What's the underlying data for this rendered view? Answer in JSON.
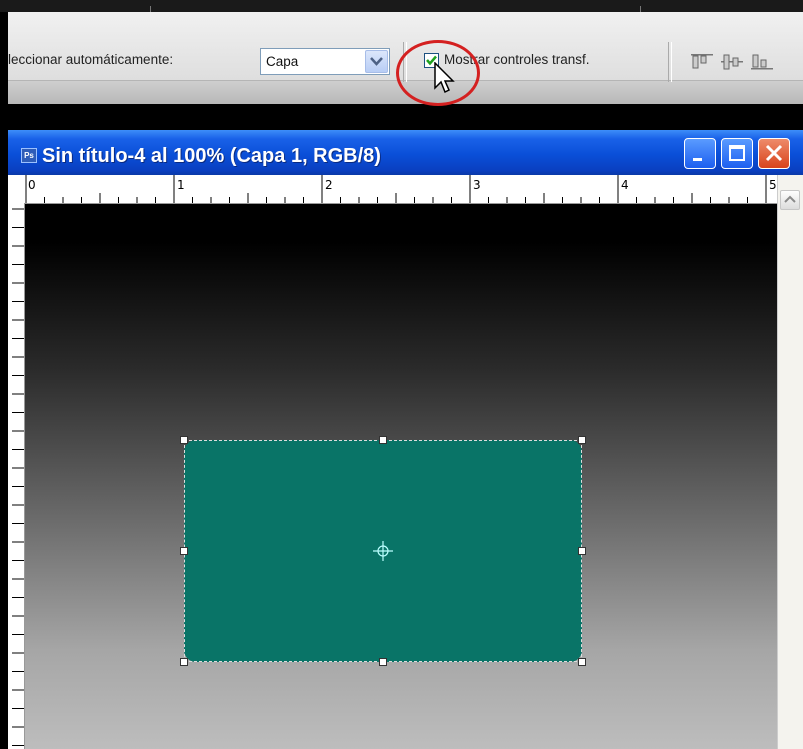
{
  "options_bar": {
    "autoselect_label": "leccionar automáticamente:",
    "autoselect_value": "Capa",
    "show_transform_label": "Mostrar controles transf.",
    "show_transform_checked": true
  },
  "document": {
    "title": "Sin título-4 al 100% (Capa 1, RGB/8)",
    "app_badge": "Ps"
  },
  "ruler": {
    "h_labels": [
      "0",
      "1",
      "2",
      "3",
      "4",
      "5"
    ]
  },
  "colors": {
    "layer_fill": "#097467",
    "titlebar": "#0a4fd8",
    "highlight_circle": "#d42020"
  },
  "icons": [
    "chevron-down-icon",
    "checkmark-icon",
    "mouse-pointer-icon",
    "align-top-icon",
    "align-vcenter-icon",
    "align-bottom-icon",
    "minimize-icon",
    "maximize-icon",
    "close-icon",
    "center-pivot-icon",
    "scroll-up-icon"
  ]
}
